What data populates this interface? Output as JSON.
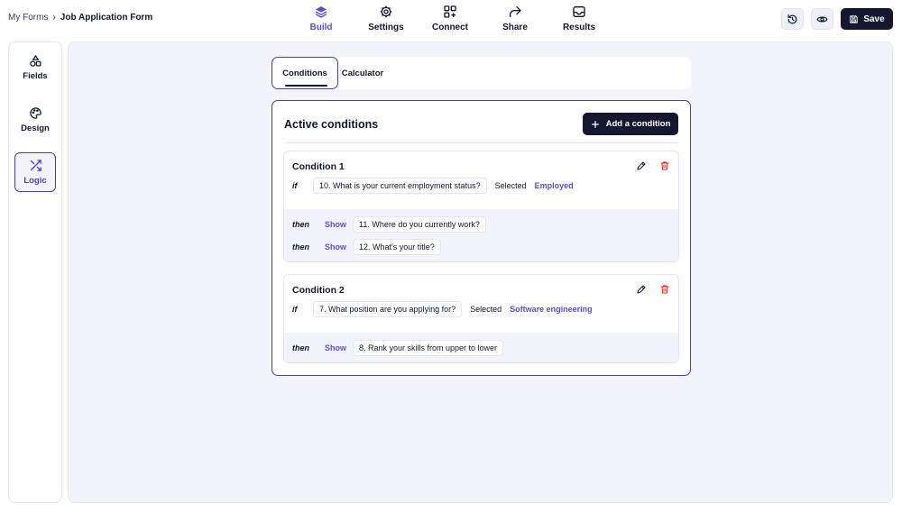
{
  "breadcrumb": {
    "parent": "My Forms",
    "separator": "›",
    "current": "Job Application Form"
  },
  "nav": {
    "items": [
      {
        "label": "Build",
        "icon": "layers-icon",
        "active": true
      },
      {
        "label": "Settings",
        "icon": "gear-icon",
        "active": false
      },
      {
        "label": "Connect",
        "icon": "integration-grid-icon",
        "active": false
      },
      {
        "label": "Share",
        "icon": "share-arrow-icon",
        "active": false
      },
      {
        "label": "Results",
        "icon": "inbox-icon",
        "active": false
      }
    ]
  },
  "toolbar": {
    "history_icon": "history-icon",
    "preview_icon": "eye-icon",
    "save_label": "Save"
  },
  "sidebar": {
    "items": [
      {
        "label": "Fields",
        "icon": "shapes-icon",
        "active": false
      },
      {
        "label": "Design",
        "icon": "palette-icon",
        "active": false
      },
      {
        "label": "Logic",
        "icon": "shuffle-icon",
        "active": true
      }
    ]
  },
  "tabs": {
    "conditions": "Conditions",
    "calculator": "Calculator"
  },
  "panel": {
    "title": "Active conditions",
    "add_button": "Add a condition"
  },
  "conditions": [
    {
      "title": "Condition 1",
      "if_keyword": "if",
      "question": "10. What is your current employment status?",
      "operator": "Selected",
      "value": "Employed",
      "then": [
        {
          "keyword": "then",
          "action": "Show",
          "target": "11. Where do you currently work?"
        },
        {
          "keyword": "then",
          "action": "Show",
          "target": "12. What's your title?"
        }
      ]
    },
    {
      "title": "Condition 2",
      "if_keyword": "if",
      "question": "7. What position are you applying for?",
      "operator": "Selected",
      "value": "Software engineering",
      "then": [
        {
          "keyword": "then",
          "action": "Show",
          "target": "8. Rank your skills from upper to lower"
        }
      ]
    }
  ],
  "colors": {
    "accent": "#5b4fcf",
    "active_border": "#4c3fb5",
    "dark_button": "#15162f",
    "canvas_bg": "#f3f4fb",
    "delete_red": "#dc2626"
  }
}
